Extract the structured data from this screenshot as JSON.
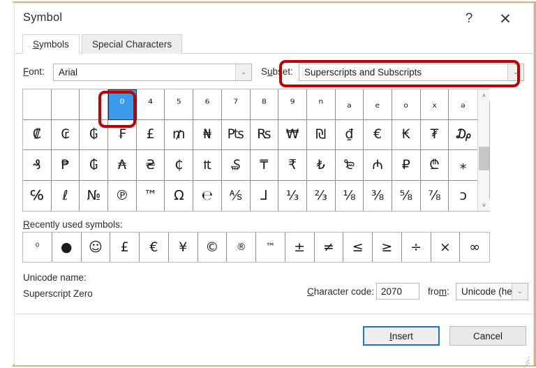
{
  "window": {
    "title": "Symbol",
    "help_icon": "question-mark-icon",
    "help_label": "?",
    "close_label": "✕"
  },
  "tabs": [
    {
      "label": "Symbols",
      "accel": "S",
      "rest": "ymbols",
      "active": true
    },
    {
      "label": "Special Characters",
      "accel": "S",
      "rest": "pecial Characters",
      "active": false
    }
  ],
  "selectors": {
    "font_label_accel": "F",
    "font_label_rest": "ont:",
    "font_value": "Arial",
    "subset_label_accel": "u",
    "subset_label_pre": "S",
    "subset_label_post": "bset:",
    "subset_value": "Superscripts and Subscripts",
    "dropdown_arrow": "⌄"
  },
  "grid": {
    "rows": 4,
    "columns": 16,
    "selected_index": 3,
    "cells": [
      "",
      "",
      "",
      "⁰",
      "⁴",
      "⁵",
      "⁶",
      "⁷",
      "⁸",
      "⁹",
      "ⁿ",
      "ₐ",
      "ₑ",
      "ₒ",
      "ₓ",
      "ₔ",
      "₡",
      "₢",
      "₲",
      "₣",
      "£",
      "₥",
      "₦",
      "₧",
      "₨",
      "₩",
      "₪",
      "₫",
      "€",
      "₭",
      "₮",
      "₯",
      "₰",
      "₱",
      "₲",
      "₳",
      "₴",
      "₵",
      "₶",
      "₷",
      "₸",
      "₹",
      "₺",
      "₻",
      "₼",
      "₽",
      "₾",
      "⁎",
      "℅",
      "ℓ",
      "№",
      "℗",
      "™",
      "Ω",
      "℮",
      "⅍",
      "⅃",
      "⅓",
      "⅔",
      "⅛",
      "⅜",
      "⅝",
      "⅞",
      "ↄ"
    ],
    "scrollbar": {
      "up_arrow": "˄",
      "down_arrow": "˅"
    }
  },
  "recent": {
    "label_accel": "R",
    "label_rest": "ecently used symbols:",
    "symbols": [
      "⁰",
      "●",
      "☺",
      "£",
      "€",
      "¥",
      "©",
      "®",
      "™",
      "±",
      "≠",
      "≤",
      "≥",
      "÷",
      "×",
      "∞"
    ]
  },
  "info": {
    "unicode_name_label": "Unicode name:",
    "unicode_name_value": "Superscript Zero",
    "charcode_label_accel": "C",
    "charcode_label_rest": "haracter code:",
    "charcode_value": "2070",
    "from_label_pre": "fro",
    "from_label_accel": "m",
    "from_label_post": ":",
    "from_value": "Unicode (hex)"
  },
  "buttons": {
    "insert_accel": "I",
    "insert_rest": "nsert",
    "cancel_label": "Cancel"
  },
  "annotations": {
    "accent_color": "#c00000",
    "subset_box": "Superscripts and Subscripts subset dropdown",
    "cell_box": "Superscript Zero character cell"
  },
  "colors": {
    "selection_blue": "#3d9ae8",
    "focus_blue": "#1a75c6",
    "annotation_red": "#c00000"
  }
}
